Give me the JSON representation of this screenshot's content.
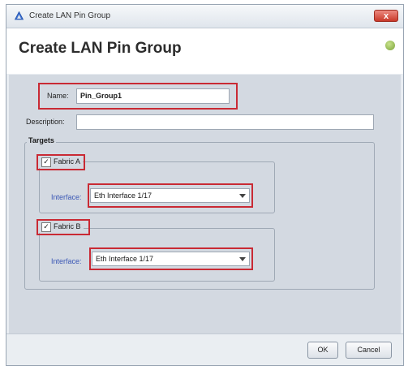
{
  "window": {
    "title": "Create LAN Pin Group",
    "close_label": "x"
  },
  "header": {
    "title": "Create LAN Pin Group"
  },
  "form": {
    "name_label": "Name:",
    "name_value": "Pin_Group1",
    "description_label": "Description:",
    "description_value": ""
  },
  "targets": {
    "legend": "Targets",
    "fabric_a": {
      "label": "Fabric A",
      "checked": "✓",
      "interface_label": "Interface:",
      "interface_value": "Eth Interface 1/17"
    },
    "fabric_b": {
      "label": "Fabric B",
      "checked": "✓",
      "interface_label": "Interface:",
      "interface_value": "Eth Interface 1/17"
    }
  },
  "footer": {
    "ok_label": "OK",
    "cancel_label": "Cancel"
  },
  "colors": {
    "highlight": "#c92a34",
    "content_bg": "#d3d9e1",
    "interface_label": "#3a57b5"
  }
}
